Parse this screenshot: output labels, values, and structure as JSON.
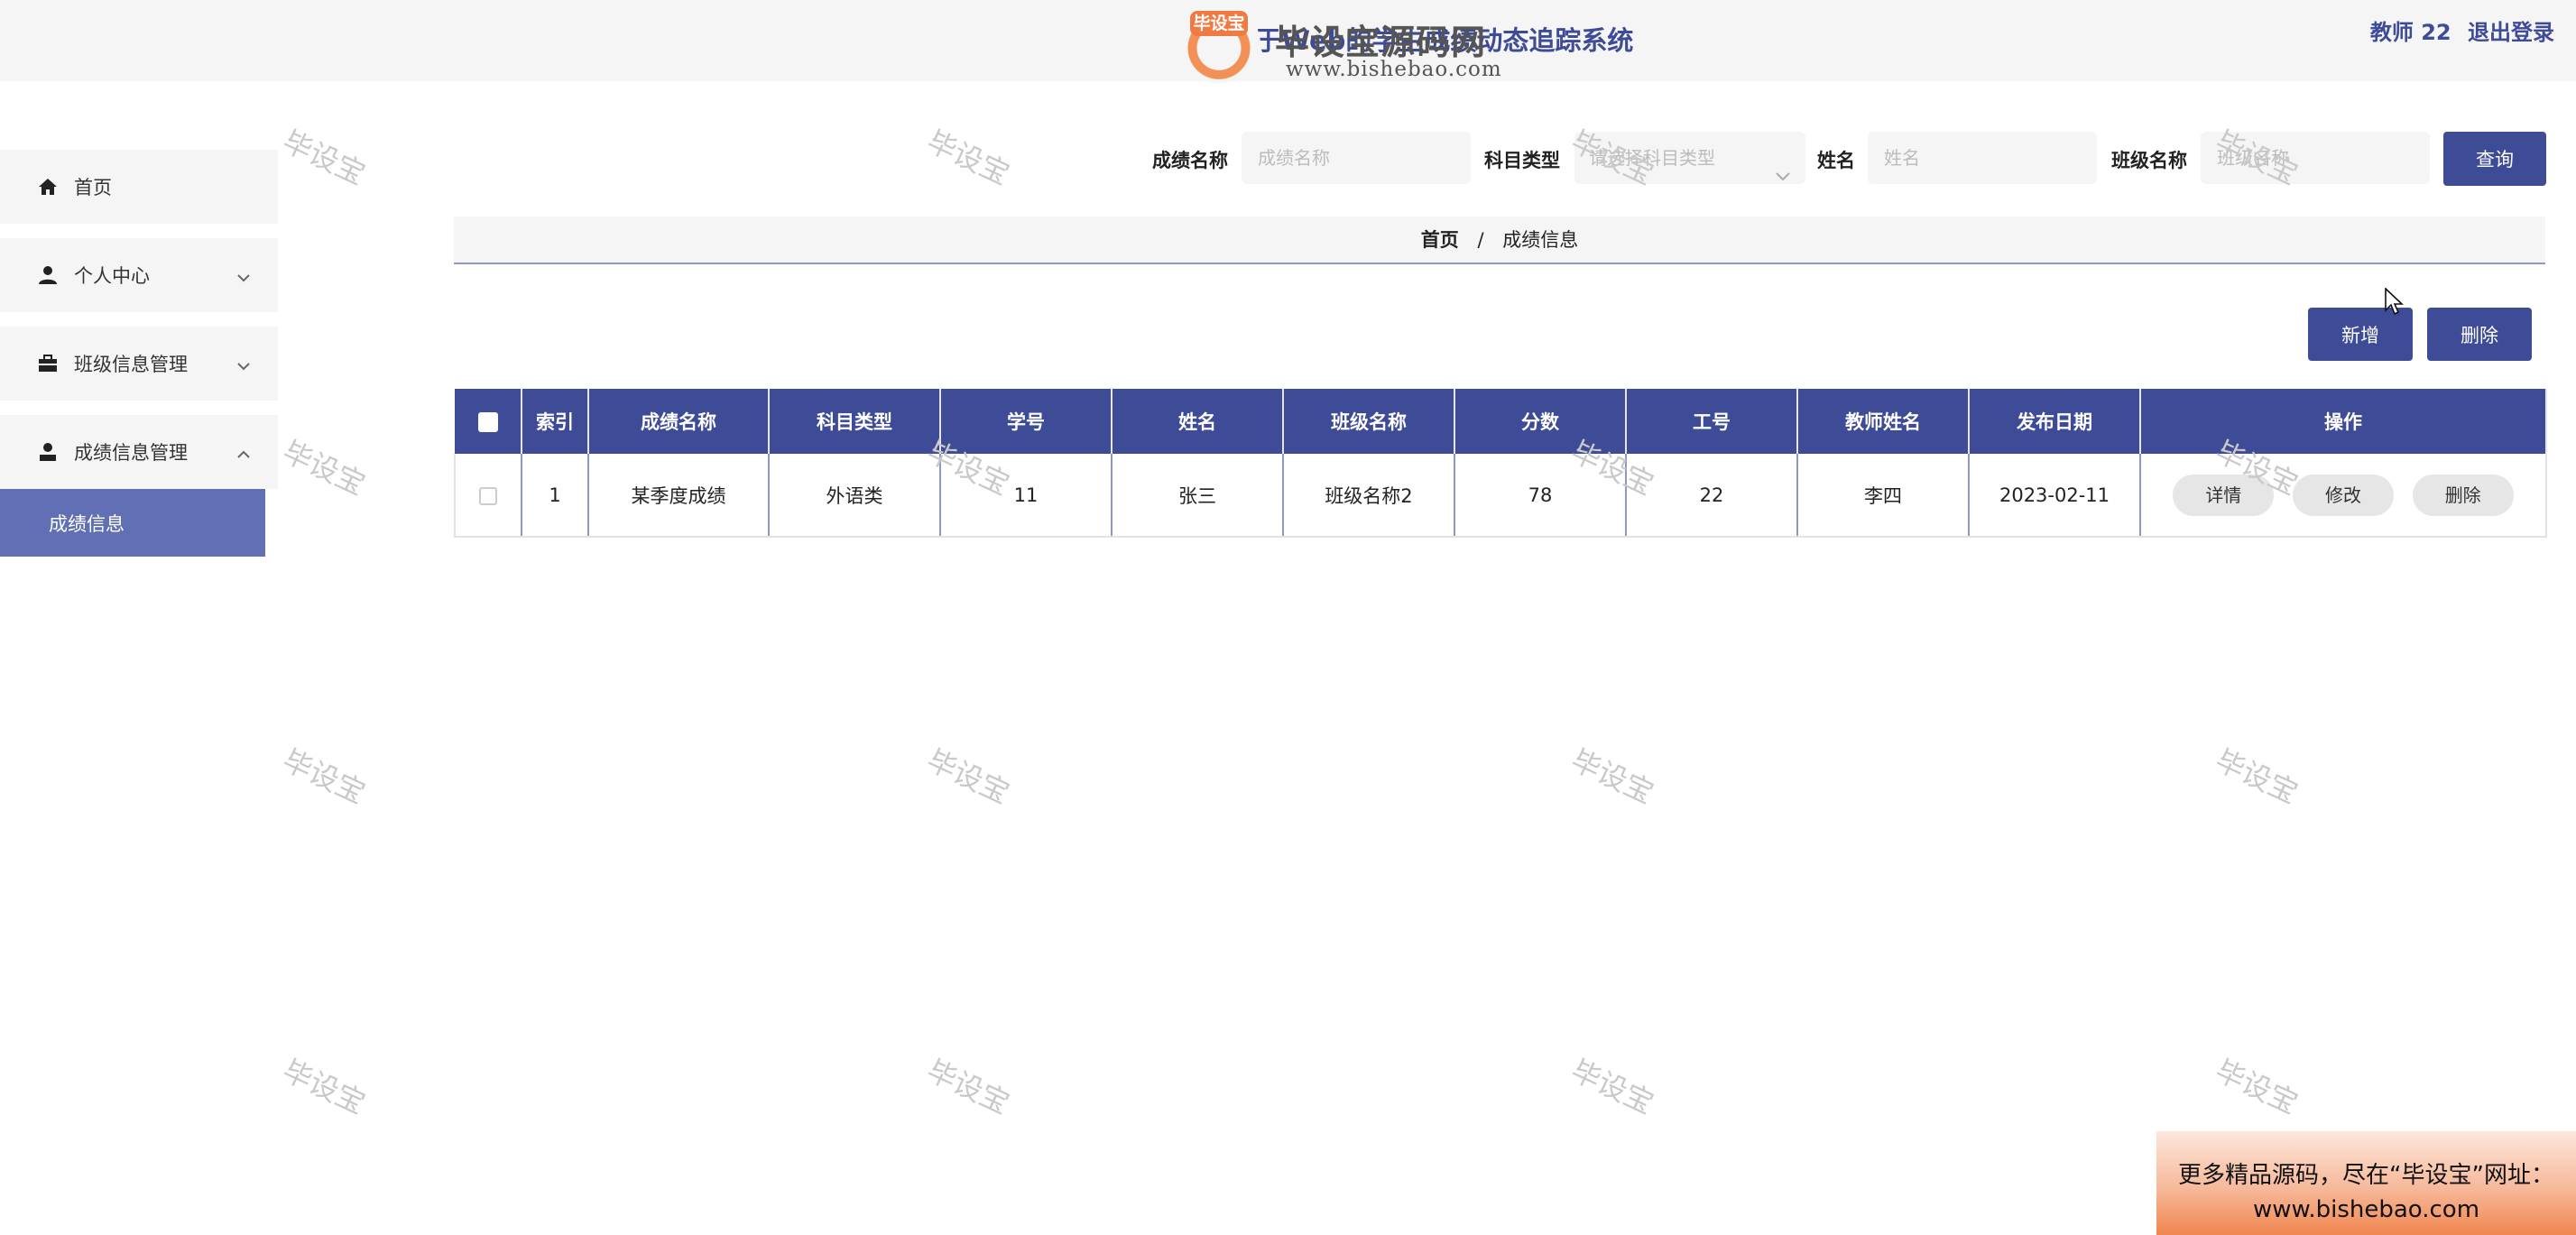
{
  "header": {
    "system_title": "基于Web的学生成绩动态追踪系统",
    "user_label": "教师 22",
    "logout_label": "退出登录"
  },
  "logo": {
    "badge_text": "毕设宝",
    "brand_text": "毕设宝源码网",
    "url": "www.bishebao.com"
  },
  "sidebar": {
    "items": [
      {
        "label": "首页",
        "icon": "home-icon",
        "expandable": false
      },
      {
        "label": "个人中心",
        "icon": "user-icon",
        "expandable": true,
        "expanded": false
      },
      {
        "label": "班级信息管理",
        "icon": "briefcase-icon",
        "expandable": true,
        "expanded": false
      },
      {
        "label": "成绩信息管理",
        "icon": "person-icon",
        "expandable": true,
        "expanded": true
      }
    ],
    "submenu": {
      "label": "成绩信息",
      "active": true
    }
  },
  "search": {
    "fields": [
      {
        "label": "成绩名称",
        "placeholder": "成绩名称",
        "value": ""
      },
      {
        "label": "科目类型",
        "placeholder": "请选择科目类型",
        "value": ""
      },
      {
        "label": "姓名",
        "placeholder": "姓名",
        "value": ""
      },
      {
        "label": "班级名称",
        "placeholder": "班级名称",
        "value": ""
      }
    ],
    "query_label": "查询"
  },
  "breadcrumb": {
    "home": "首页",
    "separator": "/",
    "current": "成绩信息"
  },
  "actions": {
    "add_label": "新增",
    "delete_label": "删除"
  },
  "table": {
    "headers": [
      "索引",
      "成绩名称",
      "科目类型",
      "学号",
      "姓名",
      "班级名称",
      "分数",
      "工号",
      "教师姓名",
      "发布日期",
      "操作"
    ],
    "rows": [
      {
        "index": "1",
        "name": "某季度成绩",
        "subject": "外语类",
        "student_no": "11",
        "student_name": "张三",
        "class_name": "班级名称2",
        "score": "78",
        "staff_no": "22",
        "teacher": "李四",
        "date": "2023-02-11"
      }
    ],
    "row_actions": [
      "详情",
      "修改",
      "删除"
    ]
  },
  "watermark_text": "毕设宝",
  "promo": {
    "line1": "更多精品源码，尽在“毕设宝”网址：",
    "line2": "www.bishebao.com"
  },
  "colors": {
    "primary": "#3e4b97",
    "sidebar_active": "#6170b4",
    "panel_bg": "#f6f5f5"
  }
}
